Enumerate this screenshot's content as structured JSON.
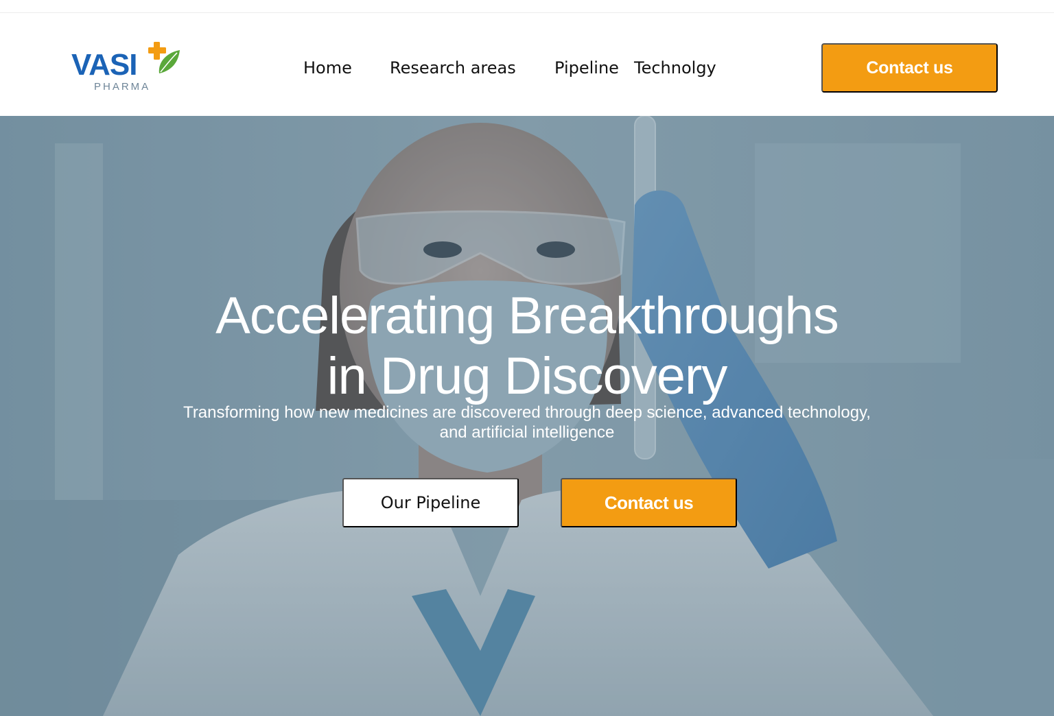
{
  "brand": {
    "name": "VASI",
    "subtitle": "PHARMA",
    "primary_color": "#1b63b6",
    "accent_color": "#f39c12",
    "leaf_color": "#5aa83a"
  },
  "nav": {
    "items": [
      {
        "label": "Home"
      },
      {
        "label": "Research areas"
      },
      {
        "label": "Pipeline"
      },
      {
        "label": "Technolgy"
      }
    ]
  },
  "header": {
    "cta_label": "Contact us"
  },
  "hero": {
    "title_line1": "Accelerating Breakthroughs",
    "title_line2": "in Drug Discovery",
    "subtitle_line1": "Transforming how new medicines are discovered through deep science, advanced technology,",
    "subtitle_line2": "and artificial intelligence",
    "primary_button": "Our Pipeline",
    "secondary_button": "Contact us",
    "image": "scientist-in-lab-holding-test-tube"
  }
}
